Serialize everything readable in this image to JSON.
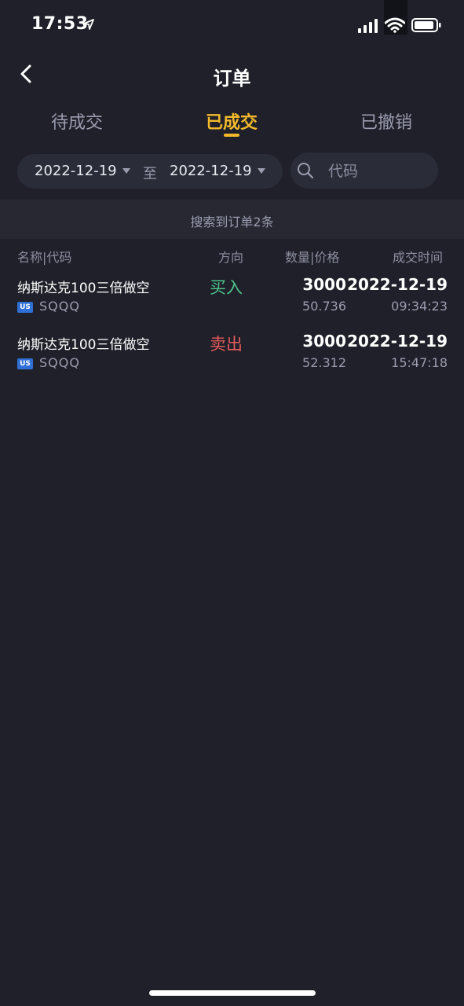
{
  "status_bar": {
    "time": "17:53",
    "icons": [
      "location-arrow-icon",
      "signal-icon",
      "wifi-icon",
      "battery-icon"
    ]
  },
  "header": {
    "title": "订单",
    "back_icon": "chevron-left-icon"
  },
  "tabs": [
    {
      "label": "待成交",
      "active": false
    },
    {
      "label": "已成交",
      "active": true
    },
    {
      "label": "已撤销",
      "active": false
    }
  ],
  "filter": {
    "start_date": "2022-12-19",
    "to_label": "至",
    "end_date": "2022-12-19",
    "search_placeholder": "代码"
  },
  "summary": {
    "text": "搜索到订单2条"
  },
  "table": {
    "headers": {
      "name_code": "名称|代码",
      "direction": "方向",
      "qty_price": "数量|价格",
      "time": "成交时间"
    },
    "rows": [
      {
        "name": "纳斯达克100三倍做空",
        "market": "US",
        "code": "SQQQ",
        "direction": "买入",
        "direction_color": "#4cc38a",
        "qty": "3000",
        "price": "50.736",
        "date": "2022-12-19",
        "time": "09:34:23"
      },
      {
        "name": "纳斯达克100三倍做空",
        "market": "US",
        "code": "SQQQ",
        "direction": "卖出",
        "direction_color": "#e25a5a",
        "qty": "3000",
        "price": "52.312",
        "date": "2022-12-19",
        "time": "15:47:18"
      }
    ]
  },
  "colors": {
    "background": "#1f2029",
    "accent": "#f3b92b",
    "buy": "#4cc38a",
    "sell": "#e25a5a"
  }
}
